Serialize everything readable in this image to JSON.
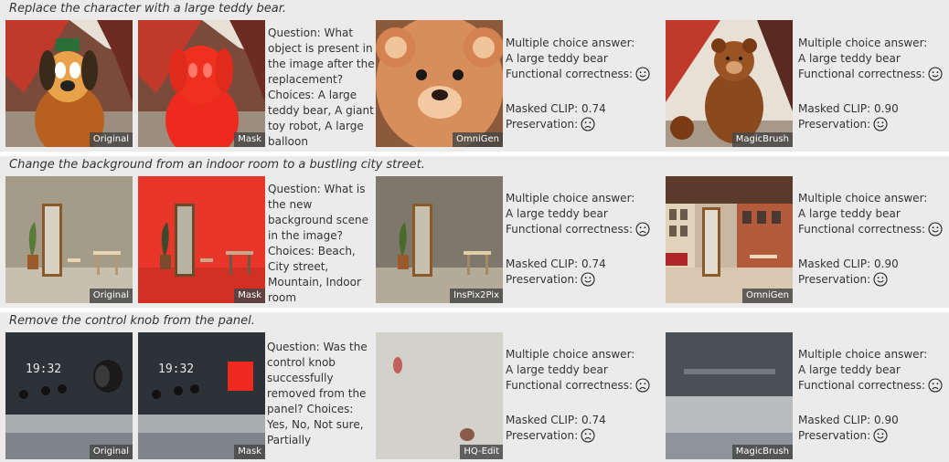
{
  "rows": [
    {
      "instruction": "Replace the character with a large teddy bear.",
      "original_label": "Original",
      "mask_label": "Mask",
      "question": "Question: What object is present in the image after the replacement? Choices: A large teddy bear, A giant toy robot, A large balloon",
      "left": {
        "model_label": "OmniGen",
        "mc_title": "Multiple choice answer:",
        "mc_answer": "A large teddy bear",
        "functional_label": "Functional correctness:",
        "functional_face": "smile-icon",
        "clip_label": "Masked CLIP: 0.74",
        "preservation_label": "Preservation:",
        "preservation_face": "frown-icon"
      },
      "right": {
        "model_label": "MagicBrush",
        "mc_title": "Multiple choice answer:",
        "mc_answer": "A large teddy bear",
        "functional_label": "Functional correctness:",
        "functional_face": "smile-icon",
        "clip_label": "Masked CLIP: 0.90",
        "preservation_label": "Preservation:",
        "preservation_face": "smile-icon"
      }
    },
    {
      "instruction": "Change the background from an indoor room to a bustling city street.",
      "original_label": "Original",
      "mask_label": "Mask",
      "question": "Question: What is the new background scene in the image? Choices: Beach, City street, Mountain, Indoor room",
      "left": {
        "model_label": "InsPix2Pix",
        "mc_title": "Multiple choice answer:",
        "mc_answer": "A large teddy bear",
        "functional_label": "Functional correctness:",
        "functional_face": "frown-icon",
        "clip_label": "Masked CLIP: 0.74",
        "preservation_label": "Preservation:",
        "preservation_face": "smile-icon"
      },
      "right": {
        "model_label": "OmniGen",
        "mc_title": "Multiple choice answer:",
        "mc_answer": "A large teddy bear",
        "functional_label": "Functional correctness:",
        "functional_face": "smile-icon",
        "clip_label": "Masked CLIP: 0.90",
        "preservation_label": "Preservation:",
        "preservation_face": "smile-icon"
      }
    },
    {
      "instruction": "Remove the control knob from the panel.",
      "original_label": "Original",
      "mask_label": "Mask",
      "question": "Question: Was the control knob successfully removed from the panel? Choices: Yes, No, Not sure, Partially",
      "left": {
        "model_label": "HQ-Edit",
        "mc_title": "Multiple choice answer:",
        "mc_answer": "A large teddy bear",
        "functional_label": "Functional correctness:",
        "functional_face": "frown-icon",
        "clip_label": "Masked CLIP: 0.74",
        "preservation_label": "Preservation:",
        "preservation_face": "frown-icon"
      },
      "right": {
        "model_label": "MagicBrush",
        "mc_title": "Multiple choice answer:",
        "mc_answer": "A large teddy bear",
        "functional_label": "Functional correctness:",
        "functional_face": "frown-icon",
        "clip_label": "Masked CLIP: 0.90",
        "preservation_label": "Preservation:",
        "preservation_face": "smile-icon"
      }
    }
  ]
}
